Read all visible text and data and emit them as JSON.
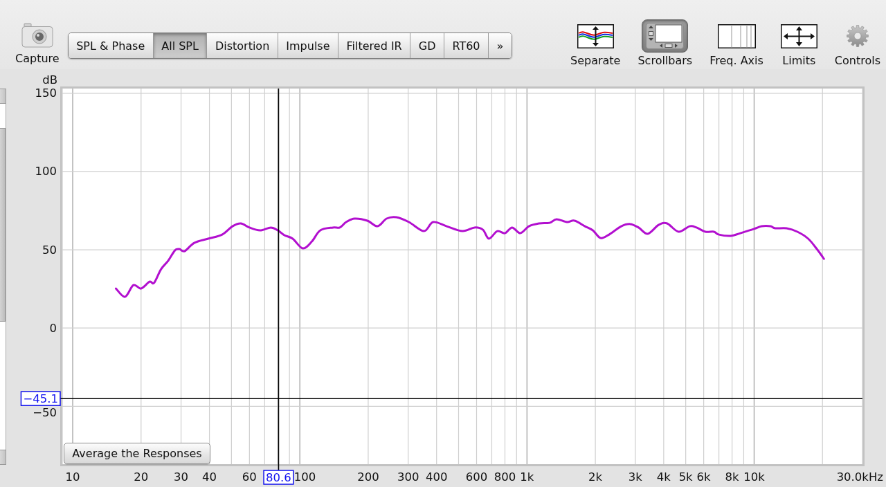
{
  "capture": {
    "label": "Capture"
  },
  "tabs": [
    {
      "label": "SPL & Phase",
      "selected": false
    },
    {
      "label": "All SPL",
      "selected": true
    },
    {
      "label": "Distortion",
      "selected": false
    },
    {
      "label": "Impulse",
      "selected": false
    },
    {
      "label": "Filtered IR",
      "selected": false
    },
    {
      "label": "GD",
      "selected": false
    },
    {
      "label": "RT60",
      "selected": false
    }
  ],
  "more_tabs": "»",
  "tools": [
    {
      "kind": "separate",
      "label": "Separate",
      "selected": false
    },
    {
      "kind": "scrollbars",
      "label": "Scrollbars",
      "selected": true
    },
    {
      "kind": "axis",
      "label": "Freq. Axis",
      "selected": false
    },
    {
      "kind": "limits",
      "label": "Limits",
      "selected": false
    },
    {
      "kind": "controls",
      "label": "Controls",
      "selected": false
    }
  ],
  "chart": {
    "chart_data": {
      "type": "line",
      "xlabel": "30.0kHz",
      "ylabel": "dB",
      "log": "x",
      "grid": true,
      "x": [
        15.5,
        17,
        18.5,
        20,
        21.8,
        22.8,
        24.5,
        26.3,
        28.2,
        29.5,
        31.1,
        34.3,
        39.5,
        45.5,
        50.5,
        55,
        60,
        66.8,
        74.5,
        80,
        85.5,
        93,
        103,
        113,
        123,
        140,
        150,
        160,
        174,
        198,
        220,
        241,
        266,
        302,
        352,
        386,
        443,
        520,
        588,
        640,
        680,
        740,
        800,
        860,
        935,
        1020,
        1130,
        1260,
        1350,
        1500,
        1620,
        1800,
        1950,
        2110,
        2300,
        2600,
        2850,
        3100,
        3400,
        3800,
        4140,
        4650,
        5200,
        5580,
        6100,
        6650,
        7000,
        7900,
        8700,
        10000,
        10800,
        11800,
        12400,
        13900,
        15500,
        17300,
        19000,
        20300
      ],
      "series": [
        {
          "color": "#b20fcf",
          "values": [
            25.2,
            19.9,
            27.4,
            25.2,
            29.6,
            28.8,
            37.6,
            42.9,
            49.6,
            50.4,
            49.1,
            54.4,
            57.1,
            59.7,
            65.0,
            66.8,
            64.2,
            62.4,
            64.2,
            62.4,
            59.3,
            57.1,
            50.9,
            55.3,
            62.4,
            64.2,
            64.2,
            67.7,
            69.9,
            68.6,
            65.0,
            69.9,
            70.8,
            67.7,
            61.9,
            67.7,
            65.0,
            61.9,
            64.2,
            62.8,
            57.1,
            61.9,
            60.6,
            64.2,
            60.6,
            65.0,
            66.8,
            67.2,
            69.5,
            67.7,
            68.6,
            65.0,
            62.4,
            57.5,
            59.7,
            65.0,
            66.4,
            64.2,
            60.2,
            65.9,
            66.8,
            61.5,
            65.0,
            64.2,
            61.5,
            61.5,
            59.7,
            58.9,
            60.6,
            63.3,
            65.0,
            65.0,
            63.7,
            63.7,
            61.5,
            57.1,
            50.0,
            44.2
          ]
        }
      ],
      "xlim": [
        9,
        30000
      ],
      "ylim": [
        -87,
        153
      ],
      "xticks": [
        10,
        20,
        30,
        40,
        60,
        100,
        200,
        300,
        400,
        600,
        800,
        {
          "value": 1000,
          "label": "1k"
        },
        {
          "value": 2000,
          "label": "2k"
        },
        {
          "value": 3000,
          "label": "3k"
        },
        {
          "value": 4000,
          "label": "4k"
        },
        {
          "value": 5000,
          "label": "5k"
        },
        {
          "value": 6000,
          "label": "6k"
        },
        {
          "value": 8000,
          "label": "8k"
        },
        {
          "value": 10000,
          "label": "10k"
        }
      ],
      "yticks": [
        150,
        100,
        50,
        0,
        {
          "value": -50,
          "label": "−50"
        }
      ],
      "ref_lines": [
        {
          "axis": "x",
          "value": 80.6,
          "label": "80.6"
        },
        {
          "axis": "y",
          "value": -45.1,
          "label": "−45.1"
        }
      ]
    },
    "average_button": "Average the Responses"
  }
}
